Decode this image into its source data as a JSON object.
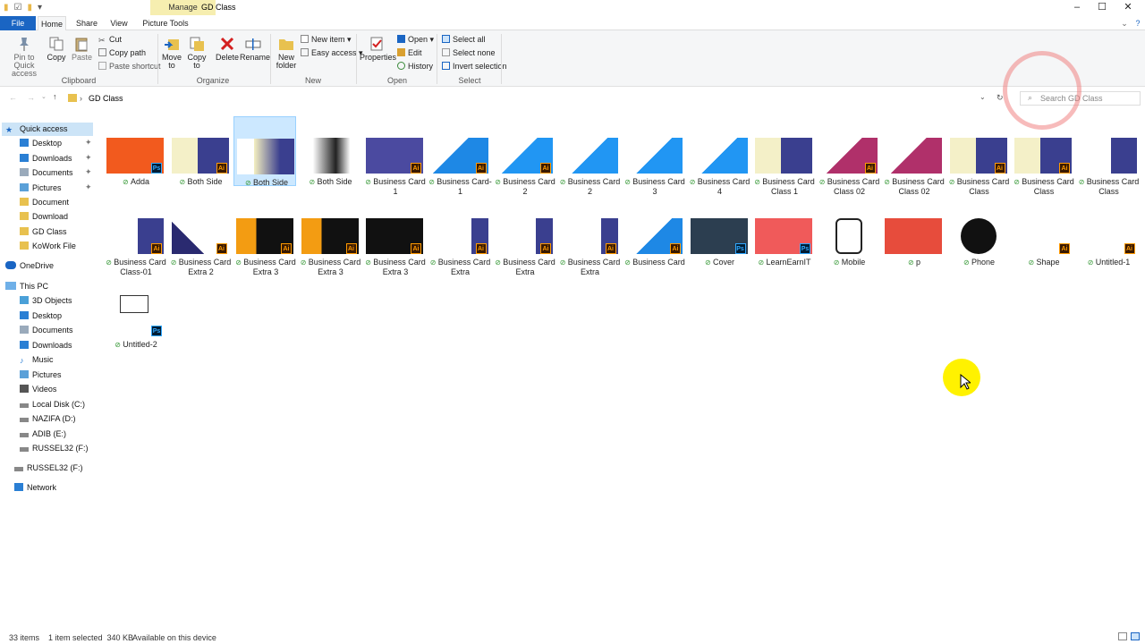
{
  "window": {
    "title": "GD Class",
    "manage": "Manage",
    "minimize": "–",
    "maximize": "☐",
    "close": "✕",
    "help": "?"
  },
  "tabs": {
    "file": "File",
    "home": "Home",
    "share": "Share",
    "view": "View",
    "picture_tools": "Picture Tools"
  },
  "ribbon": {
    "clipboard": {
      "label": "Clipboard",
      "pin": "Pin to Quick access",
      "copy": "Copy",
      "paste": "Paste",
      "cut": "Cut",
      "copy_path": "Copy path",
      "paste_shortcut": "Paste shortcut"
    },
    "organize": {
      "label": "Organize",
      "move_to": "Move to",
      "copy_to": "Copy to",
      "delete": "Delete",
      "rename": "Rename"
    },
    "new": {
      "label": "New",
      "new_folder": "New folder",
      "new_item": "New item",
      "easy_access": "Easy access"
    },
    "open": {
      "label": "Open",
      "properties": "Properties",
      "open": "Open",
      "edit": "Edit",
      "history": "History"
    },
    "select": {
      "label": "Select",
      "select_all": "Select all",
      "select_none": "Select none",
      "invert": "Invert selection"
    }
  },
  "address": {
    "path": "GD Class",
    "search_placeholder": "Search GD Class"
  },
  "nav": {
    "quick_access": "Quick access",
    "quick_items": [
      "Desktop",
      "Downloads",
      "Documents",
      "Pictures",
      "Document",
      "Download",
      "GD Class",
      "KoWork File"
    ],
    "onedrive": "OneDrive",
    "this_pc": "This PC",
    "pc_items": [
      "3D Objects",
      "Desktop",
      "Documents",
      "Downloads",
      "Music",
      "Pictures",
      "Videos",
      "Local Disk (C:)",
      "NAZIFA (D:)",
      "ADIB (E:)",
      "RUSSEL32 (F:)"
    ],
    "russel": "RUSSEL32 (F:)",
    "network": "Network"
  },
  "files": [
    {
      "name": "Adda",
      "badge": "Ps"
    },
    {
      "name": "Both Side",
      "badge": "Ai"
    },
    {
      "name": "Both Side",
      "badge": ""
    },
    {
      "name": "Both Side",
      "badge": ""
    },
    {
      "name": "Business Card 1",
      "badge": "Ai"
    },
    {
      "name": "Business Card-1",
      "badge": "Ai"
    },
    {
      "name": "Business Card 2",
      "badge": "Ai"
    },
    {
      "name": "Business Card 2",
      "badge": ""
    },
    {
      "name": "Business Card 3",
      "badge": ""
    },
    {
      "name": "Business Card 4",
      "badge": ""
    },
    {
      "name": "Business Card Class 1",
      "badge": ""
    },
    {
      "name": "Business Card Class 02",
      "badge": "Ai"
    },
    {
      "name": "Business Card Class 02",
      "badge": ""
    },
    {
      "name": "Business Card Class",
      "badge": "Ai"
    },
    {
      "name": "Business Card Class",
      "badge": "Ai"
    },
    {
      "name": "Business Card Class",
      "badge": ""
    },
    {
      "name": "Business Card Class-01",
      "badge": "Ai"
    },
    {
      "name": "Business Card Extra 2",
      "badge": "Ai"
    },
    {
      "name": "Business Card Extra 3",
      "badge": "Ai"
    },
    {
      "name": "Business Card Extra 3",
      "badge": "Ai"
    },
    {
      "name": "Business Card Extra 3",
      "badge": "Ai"
    },
    {
      "name": "Business Card Extra",
      "badge": "Ai"
    },
    {
      "name": "Business Card Extra",
      "badge": "Ai"
    },
    {
      "name": "Business Card Extra",
      "badge": "Ai"
    },
    {
      "name": "Business Card",
      "badge": "Ai"
    },
    {
      "name": "Cover",
      "badge": "Ps"
    },
    {
      "name": "LearnEarnIT",
      "badge": "Ps"
    },
    {
      "name": "Mobile",
      "badge": ""
    },
    {
      "name": "p",
      "badge": ""
    },
    {
      "name": "Phone",
      "badge": ""
    },
    {
      "name": "Shape",
      "badge": "Ai"
    },
    {
      "name": "Untitled-1",
      "badge": "Ai"
    },
    {
      "name": "Untitled-2",
      "badge": "Ps"
    }
  ],
  "status": {
    "items": "33 items",
    "selected": "1 item selected  340 KB",
    "availability": "Available on this device"
  }
}
